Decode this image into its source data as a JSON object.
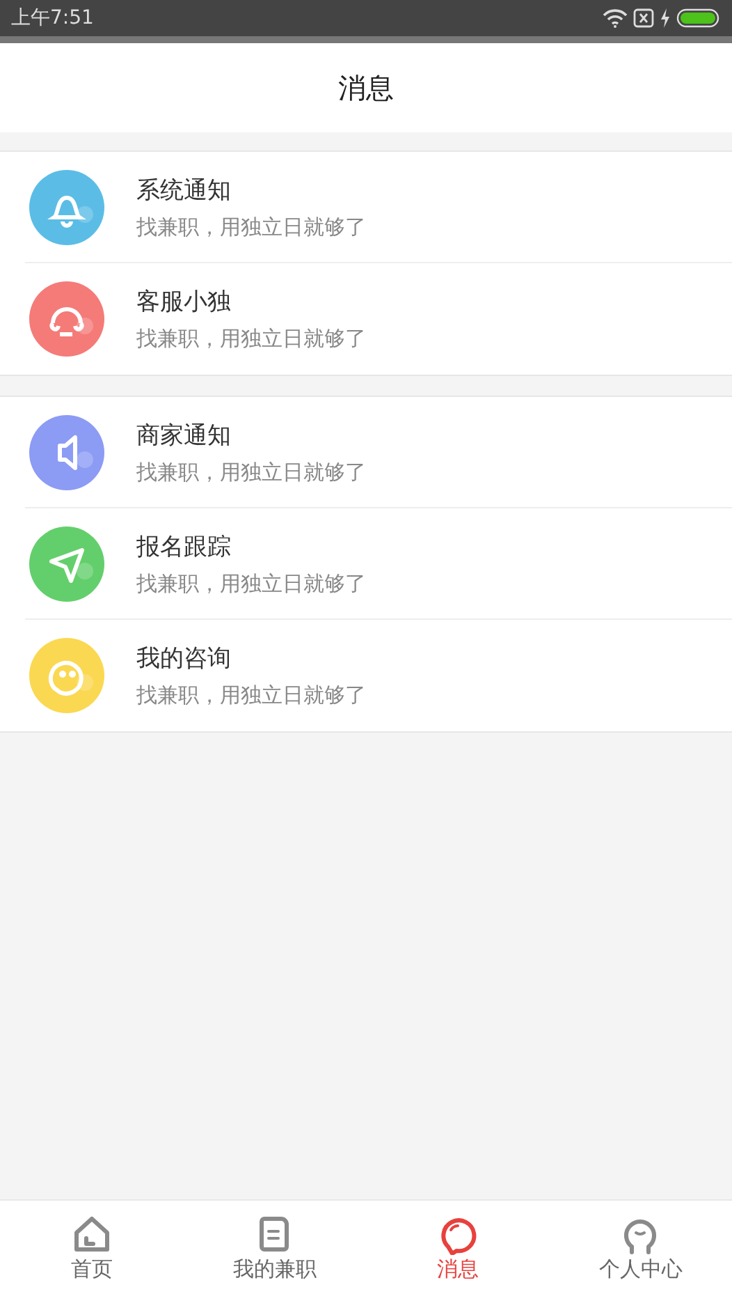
{
  "status_bar": {
    "time": "上午7:51"
  },
  "header": {
    "title": "消息"
  },
  "groups": [
    {
      "items": [
        {
          "kind": "bell",
          "color": "#5bbde6",
          "title": "系统通知",
          "subtitle": "找兼职，用独立日就够了"
        },
        {
          "kind": "headset",
          "color": "#f47b78",
          "title": "客服小独",
          "subtitle": "找兼职，用独立日就够了"
        }
      ]
    },
    {
      "items": [
        {
          "kind": "speaker",
          "color": "#8c9bf4",
          "title": "商家通知",
          "subtitle": "找兼职，用独立日就够了"
        },
        {
          "kind": "send",
          "color": "#63cf6c",
          "title": "报名跟踪",
          "subtitle": "找兼职，用独立日就够了"
        },
        {
          "kind": "chat",
          "color": "#fbd851",
          "title": "我的咨询",
          "subtitle": "找兼职，用独立日就够了"
        }
      ]
    }
  ],
  "tab_bar": [
    {
      "kind": "home",
      "label": "首页",
      "selected": false
    },
    {
      "kind": "doc",
      "label": "我的兼职",
      "selected": false
    },
    {
      "kind": "chat",
      "label": "消息",
      "selected": true
    },
    {
      "kind": "person",
      "label": "个人中心",
      "selected": false
    }
  ]
}
